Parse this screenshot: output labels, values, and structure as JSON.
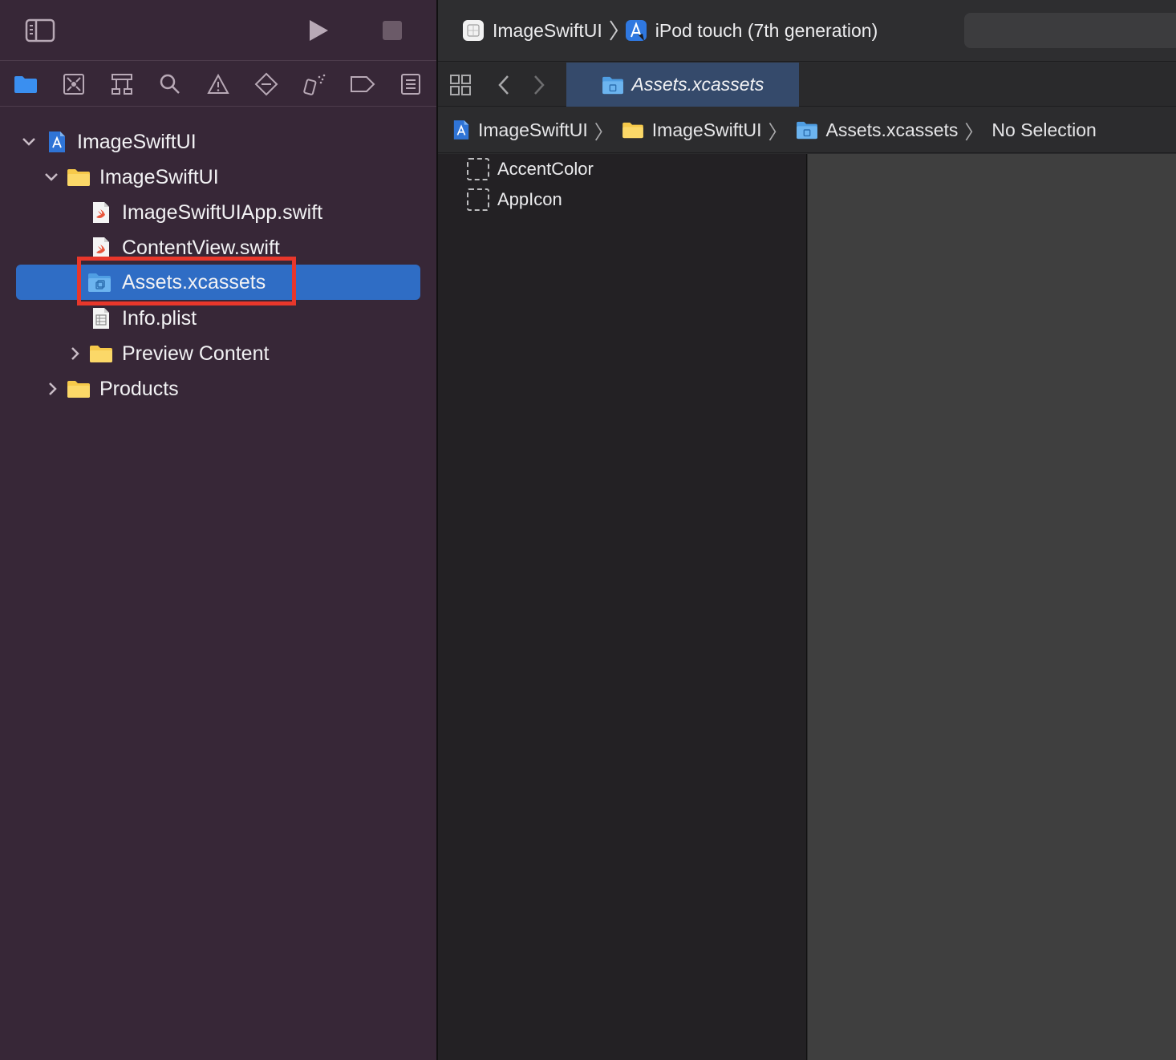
{
  "navigator": {
    "tree": [
      {
        "label": "ImageSwiftUI",
        "kind": "project",
        "expanded": true
      },
      {
        "label": "ImageSwiftUI",
        "kind": "folder",
        "expanded": true
      },
      {
        "label": "ImageSwiftUIApp.swift",
        "kind": "swift-file"
      },
      {
        "label": "ContentView.swift",
        "kind": "swift-file"
      },
      {
        "label": "Assets.xcassets",
        "kind": "asset-catalog",
        "selected": true
      },
      {
        "label": "Info.plist",
        "kind": "plist-file"
      },
      {
        "label": "Preview Content",
        "kind": "folder",
        "expanded": false
      },
      {
        "label": "Products",
        "kind": "folder",
        "expanded": false
      }
    ]
  },
  "toolbar": {
    "scheme_name": "ImageSwiftUI",
    "destination": "iPod touch (7th generation)"
  },
  "editor": {
    "active_tab": "Assets.xcassets",
    "jump_bar": [
      "ImageSwiftUI",
      "ImageSwiftUI",
      "Assets.xcassets",
      "No Selection"
    ],
    "assets": [
      "AccentColor",
      "AppIcon"
    ]
  },
  "colors": {
    "navigator_bg": "#372737",
    "selection": "#2f6dc5",
    "highlight_border": "#e8372b",
    "folder_yellow": "#f6c94a",
    "asset_folder_blue": "#5aa9e6"
  }
}
